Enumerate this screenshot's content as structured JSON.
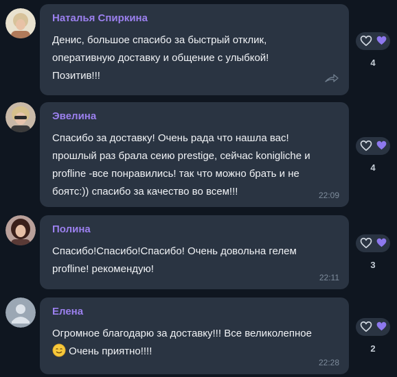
{
  "messages": [
    {
      "author": "Наталья Спиркина",
      "lines": [
        "Денис, большое спасибо за быстрый отклик,",
        "оперативную доставку и общение с улыбкой!",
        "Позитив!!!"
      ],
      "time": "",
      "reaction_count": "4"
    },
    {
      "author": "Эвелина",
      "lines": [
        "Спасибо за доставку! Очень рада что нашла вас!",
        "прошлый раз брала сеию prestige, сейчас konigliche и",
        "profline -все понравились! так что можно брать и не",
        "боятс:)) спасибо за качество во всем!!!"
      ],
      "time": "22:09",
      "reaction_count": "4"
    },
    {
      "author": "Полина",
      "lines": [
        "Спасибо!Спасибо!Спасибо! Очень довольна гелем",
        "profline! рекомендую!"
      ],
      "time": "22:11",
      "reaction_count": "3"
    },
    {
      "author": "Елена",
      "lines": [
        "Огромное благодарю за доставку!!! Все великолепное",
        "Очень приятно!!!!"
      ],
      "time": "22:28",
      "reaction_count": "2"
    }
  ],
  "colors": {
    "background": "#0f1620",
    "bubble": "#2a3442",
    "author": "#9b80ee",
    "reaction_heart": "#8e78ee",
    "time": "#7e8c9c"
  },
  "icons": {
    "reaction_outline": "heart-outline-icon",
    "reaction_filled": "purple-heart-icon",
    "forward": "forward-icon",
    "emoji": "smiling-face-emoji"
  }
}
